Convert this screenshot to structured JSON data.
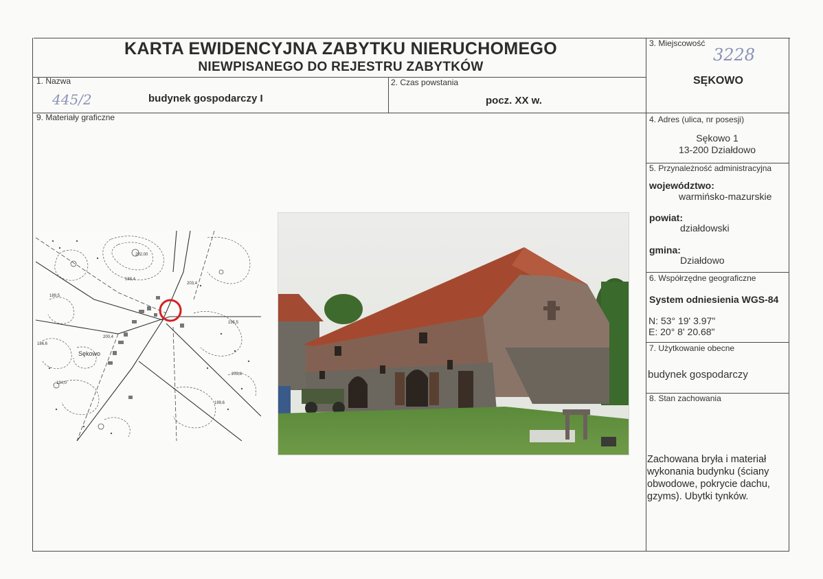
{
  "header": {
    "title_line1": "KARTA EWIDENCYJNA ZABYTKU NIERUCHOMEGO",
    "title_line2": "NIEWPISANEGO DO REJESTRU ZABYTKÓW"
  },
  "fields": {
    "nazwa": {
      "label": "1. Nazwa",
      "value": "budynek gospodarczy I",
      "handwritten": "445/2"
    },
    "czas": {
      "label": "2. Czas powstania",
      "value": "pocz. XX w."
    },
    "miejscowosc": {
      "label": "3. Miejscowość",
      "value": "SĘKOWO",
      "handwritten": "3228"
    },
    "adres": {
      "label": "4. Adres (ulica, nr posesji)",
      "line1": "Sękowo 1",
      "line2": "13-200 Działdowo"
    },
    "przynaleznosc": {
      "label": "5. Przynależność administracyjna",
      "wojewodztwo_label": "województwo:",
      "wojewodztwo": "warmińsko-mazurskie",
      "powiat_label": "powiat:",
      "powiat": "działdowski",
      "gmina_label": "gmina:",
      "gmina": "Działdowo"
    },
    "wspolrzedne": {
      "label": "6. Współrzędne geograficzne",
      "system": "System odniesienia WGS-84",
      "n": "N: 53° 19' 3.97\"",
      "e": "E: 20° 8' 20.68\""
    },
    "uzytkowanie": {
      "label": "7. Użytkowanie obecne",
      "value": "budynek gospodarczy"
    },
    "stan": {
      "label": "8. Stan zachowania",
      "value": "Zachowana bryła i materiał wykonania budynku (ściany obwodowe, pokrycie dachu, gzyms). Ubytki tynków."
    },
    "materialy": {
      "label": "9. Materiały graficzne"
    }
  },
  "map": {
    "place_label": "Sękowo",
    "elevations": [
      "202,00",
      "203,4",
      "189,5",
      "186,6",
      "195,5",
      "200,4",
      "194,0",
      "203,8",
      "199,6",
      "188,4"
    ]
  },
  "colors": {
    "marker": "#d42020",
    "roof": "#a24a32",
    "wall": "#8a6250",
    "stone": "#6e6a62",
    "grass": "#5f8a3e",
    "sky": "#e9ebe6"
  }
}
